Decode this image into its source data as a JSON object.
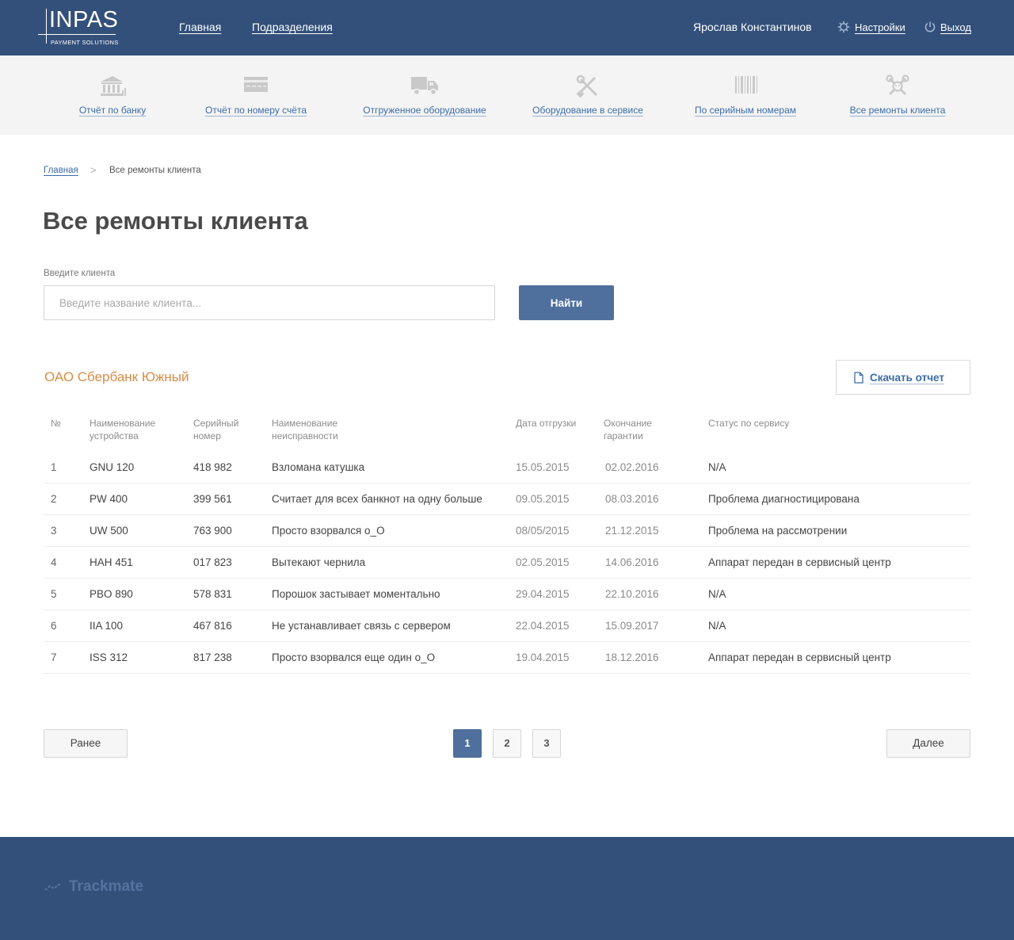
{
  "header": {
    "logo_main": "INPAS",
    "logo_sub": "PAYMENT SOLUTIONS",
    "nav": [
      "Главная",
      "Подразделения"
    ],
    "user_name": "Ярослав Константинов",
    "settings_label": "Настройки",
    "logout_label": "Выход"
  },
  "iconnav": [
    {
      "label": "Отчёт по банку",
      "icon": "bank-icon"
    },
    {
      "label": "Отчёт по номеру счёта",
      "icon": "card-icon"
    },
    {
      "label": "Отгруженное оборудование",
      "icon": "truck-icon"
    },
    {
      "label": "Оборудование в сервисе",
      "icon": "tools-icon"
    },
    {
      "label": "По серийным номерам",
      "icon": "barcode-icon"
    },
    {
      "label": "Все ремонты клиента",
      "icon": "repair-icon"
    }
  ],
  "breadcrumb": {
    "home": "Главная",
    "separator": ">",
    "current": "Все ремонты клиента"
  },
  "page_title": "Все ремонты клиента",
  "search": {
    "label": "Введите клиента",
    "placeholder": "Введите название клиента...",
    "value": "",
    "button": "Найти"
  },
  "client": {
    "name": "ОАО Сбербанк Южный",
    "download_label": "Скачать отчет"
  },
  "table": {
    "headers": [
      "№",
      "Наименование устройства",
      "Серийный номер",
      "Наименование неисправности",
      "Дата отгрузки",
      "Окончание гарантии",
      "Статус по сервису"
    ],
    "header_lines": [
      [
        "№"
      ],
      [
        "Наименование",
        "устройства"
      ],
      [
        "Серийный",
        "номер"
      ],
      [
        "Наименование",
        "неисправности"
      ],
      [
        "Дата отгрузки"
      ],
      [
        "Окончание",
        "гарантии"
      ],
      [
        "Статус по сервису"
      ]
    ],
    "rows": [
      [
        "1",
        "GNU 120",
        "418 982",
        "Взломана катушка",
        "15.05.2015",
        "02.02.2016",
        "N/A"
      ],
      [
        "2",
        "PW 400",
        "399 561",
        "Считает для всех банкнот на одну больше",
        "09.05.2015",
        "08.03.2016",
        "Проблема диагностицирована"
      ],
      [
        "3",
        "UW 500",
        "763 900",
        "Просто взорвался о_О",
        "08/05/2015",
        "21.12.2015",
        "Проблема на рассмотрении"
      ],
      [
        "4",
        "HAH 451",
        "017 823",
        "Вытекают чернила",
        "02.05.2015",
        "14.06.2016",
        "Аппарат передан в сервисный центр"
      ],
      [
        "5",
        "PBO 890",
        "578 831",
        "Порошок застывает моментально",
        "29.04.2015",
        "22.10.2016",
        "N/A"
      ],
      [
        "6",
        "IIA 100",
        "467 816",
        "Не устанавливает связь с сервером",
        "22.04.2015",
        "15.09.2017",
        "N/A"
      ],
      [
        "7",
        "ISS 312",
        "817 238",
        "Просто взорвался еще один о_О",
        "19.04.2015",
        "18.12.2016",
        "Аппарат передан в сервисный центр"
      ]
    ]
  },
  "pagination": {
    "prev": "Ранее",
    "next": "Далее",
    "pages": [
      "1",
      "2",
      "3"
    ],
    "current_page": "1"
  },
  "footer": {
    "brand": "Trackmate"
  },
  "colors": {
    "header_bg": "#33507a",
    "accent_button": "#4f6f9d",
    "link": "#3d6ca8",
    "client_name": "#d98c45",
    "nav_bg": "#f4f4f4"
  }
}
